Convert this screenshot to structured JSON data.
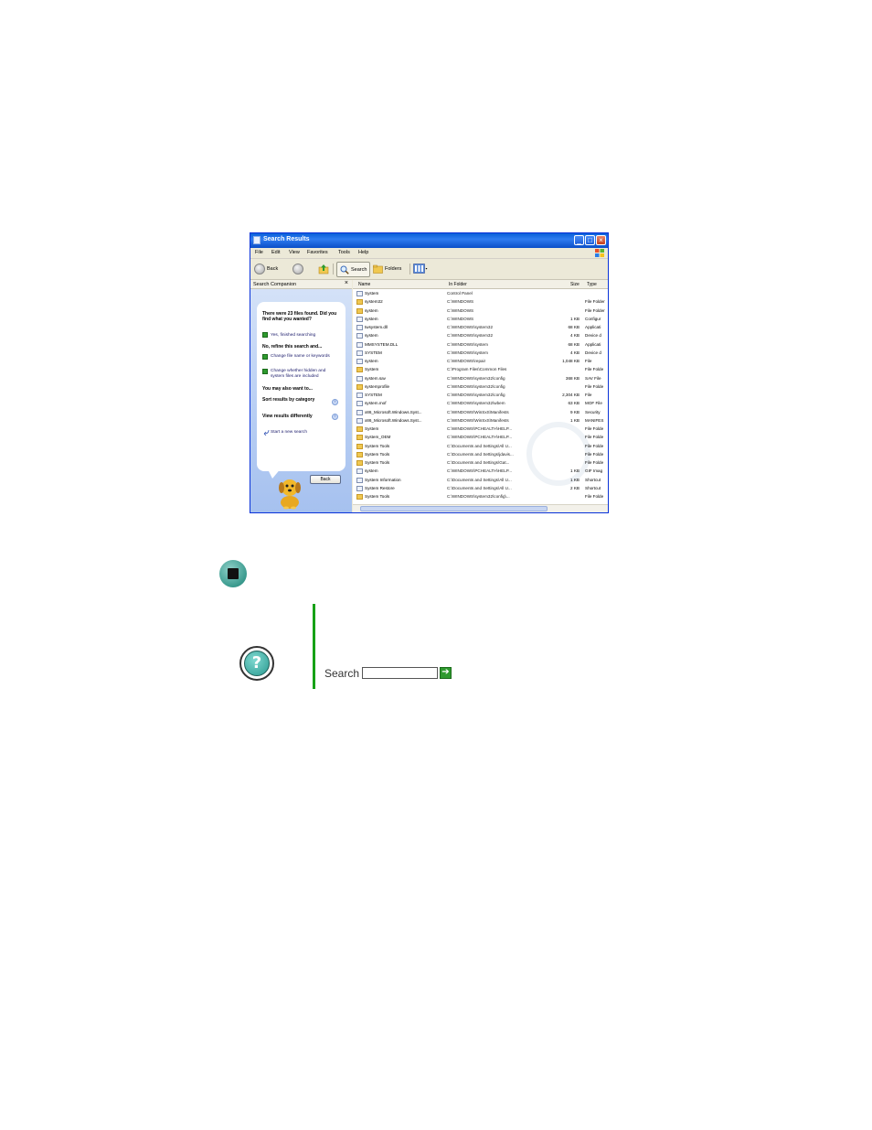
{
  "window": {
    "title": "Search Results",
    "menu": [
      "File",
      "Edit",
      "View",
      "Favorites",
      "Tools",
      "Help"
    ],
    "toolbar": {
      "back": "Back",
      "search": "Search",
      "folders": "Folders"
    }
  },
  "companion": {
    "header": "Search Companion",
    "close": "×",
    "found_text": "There were 23 files found. Did you find what you wanted?",
    "yes_option": "Yes, finished searching",
    "refine_heading": "No, refine this search and...",
    "refine_options": [
      "Change file name or keywords",
      "Change whether hidden and system files are included"
    ],
    "also_heading": "You may also want to...",
    "sort_label": "Sort results by category",
    "view_label": "View results differently",
    "new_search": "Start a new search",
    "back_button": "Back"
  },
  "results": {
    "columns": [
      "Name",
      "In Folder",
      "Size",
      "Type"
    ],
    "rows": [
      {
        "name": "System",
        "folder": "Control Panel",
        "size": "",
        "type": "",
        "icon": "file"
      },
      {
        "name": "system32",
        "folder": "C:\\WINDOWS",
        "size": "",
        "type": "File Folder",
        "icon": "folder"
      },
      {
        "name": "system",
        "folder": "C:\\WINDOWS",
        "size": "",
        "type": "File Folder",
        "icon": "folder"
      },
      {
        "name": "system",
        "folder": "C:\\WINDOWS",
        "size": "1 KB",
        "type": "Configur",
        "icon": "file"
      },
      {
        "name": "twsystem.dll",
        "folder": "C:\\WINDOWS\\system32",
        "size": "68 KB",
        "type": "Applicati",
        "icon": "file"
      },
      {
        "name": "system",
        "folder": "C:\\WINDOWS\\system32",
        "size": "4 KB",
        "type": "Device d",
        "icon": "file"
      },
      {
        "name": "MMSYSTEM.DLL",
        "folder": "C:\\WINDOWS\\system",
        "size": "68 KB",
        "type": "Applicati",
        "icon": "file"
      },
      {
        "name": "SYSTEM",
        "folder": "C:\\WINDOWS\\system",
        "size": "4 KB",
        "type": "Device d",
        "icon": "file"
      },
      {
        "name": "system",
        "folder": "C:\\WINDOWS\\repair",
        "size": "1,048 KB",
        "type": "File",
        "icon": "file"
      },
      {
        "name": "System",
        "folder": "C:\\Program Files\\Common Files",
        "size": "",
        "type": "File Folde",
        "icon": "folder"
      },
      {
        "name": "system.sav",
        "folder": "C:\\WINDOWS\\system32\\config",
        "size": "368 KB",
        "type": "SAV File",
        "icon": "file"
      },
      {
        "name": "systemprofile",
        "folder": "C:\\WINDOWS\\system32\\config",
        "size": "",
        "type": "File Folde",
        "icon": "folder"
      },
      {
        "name": "SYSTEM",
        "folder": "C:\\WINDOWS\\system32\\config",
        "size": "2,304 KB",
        "type": "File",
        "icon": "file"
      },
      {
        "name": "system.mof",
        "folder": "C:\\WINDOWS\\system32\\wbem",
        "size": "63 KB",
        "type": "MOF File",
        "icon": "file"
      },
      {
        "name": "x86_Microsoft.Windows.Syst...",
        "folder": "C:\\WINDOWS\\WinSxS\\Manifests",
        "size": "9 KB",
        "type": "Security",
        "icon": "file"
      },
      {
        "name": "x86_Microsoft.Windows.Syst...",
        "folder": "C:\\WINDOWS\\WinSxS\\Manifests",
        "size": "1 KB",
        "type": "MANIFES",
        "icon": "file"
      },
      {
        "name": "System",
        "folder": "C:\\WINDOWS\\PCHEALTH\\HELP...",
        "size": "",
        "type": "File Folde",
        "icon": "folder"
      },
      {
        "name": "System_OEM",
        "folder": "C:\\WINDOWS\\PCHEALTH\\HELP...",
        "size": "",
        "type": "File Folde",
        "icon": "folder"
      },
      {
        "name": "System Tools",
        "folder": "C:\\Documents and Settings\\All U...",
        "size": "",
        "type": "File Folde",
        "icon": "folder"
      },
      {
        "name": "System Tools",
        "folder": "C:\\Documents and Settings\\jdavis...",
        "size": "",
        "type": "File Folde",
        "icon": "folder"
      },
      {
        "name": "System Tools",
        "folder": "C:\\Documents and Settings\\Gat...",
        "size": "",
        "type": "File Folde",
        "icon": "folder"
      },
      {
        "name": "system",
        "folder": "C:\\WINDOWS\\PCHEALTH\\HELP...",
        "size": "1 KB",
        "type": "GIF Imag",
        "icon": "file"
      },
      {
        "name": "System Information",
        "folder": "C:\\Documents and Settings\\All U...",
        "size": "1 KB",
        "type": "Shortcut",
        "icon": "file"
      },
      {
        "name": "System Restore",
        "folder": "C:\\Documents and Settings\\All U...",
        "size": "2 KB",
        "type": "Shortcut",
        "icon": "file"
      },
      {
        "name": "System Tools",
        "folder": "C:\\WINDOWS\\system32\\config\\...",
        "size": "",
        "type": "File Folde",
        "icon": "folder"
      }
    ]
  },
  "help": {
    "search_label": "Search",
    "search_value": "",
    "go_symbol": "➔"
  },
  "icons": [
    "stop-icon",
    "help-icon",
    "search-companion-dog-icon",
    "xp-flag-icon"
  ]
}
